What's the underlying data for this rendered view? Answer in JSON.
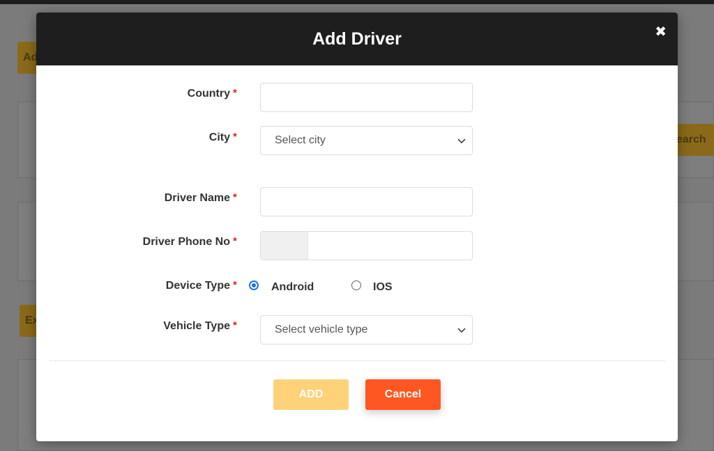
{
  "background": {
    "button_top_left": "Ad",
    "button_mid_left": "Ex",
    "button_right": "earch"
  },
  "modal": {
    "title": "Add Driver",
    "close_symbol": "✖"
  },
  "form": {
    "required_mark": "*",
    "country": {
      "label": "Country",
      "value": ""
    },
    "city": {
      "label": "City",
      "selected": "Select city"
    },
    "driver_name": {
      "label": "Driver Name",
      "value": ""
    },
    "driver_phone": {
      "label": "Driver Phone No",
      "value": ""
    },
    "device_type": {
      "label": "Device Type",
      "options": [
        "Android",
        "IOS"
      ],
      "selected": "Android"
    },
    "vehicle_type": {
      "label": "Vehicle Type",
      "selected": "Select vehicle type"
    }
  },
  "actions": {
    "add_label": "ADD",
    "cancel_label": "Cancel"
  },
  "colors": {
    "header_bg": "#1e1e1e",
    "add_button": "#ffd27a",
    "cancel_button": "#ff5722",
    "required": "#e02020",
    "radio_selected": "#1a73e8"
  }
}
